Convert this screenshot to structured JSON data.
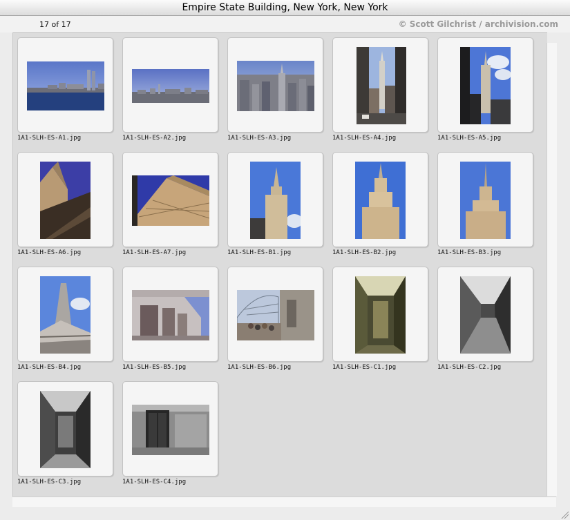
{
  "window": {
    "title": "Empire State Building, New York, New York"
  },
  "infobar": {
    "counter": "17 of 17",
    "copyright": "© Scott Gilchrist / archivision.com"
  },
  "thumbnails": [
    {
      "filename": "1A1-SLH-ES-A1.jpg",
      "orientation": "landscape"
    },
    {
      "filename": "1A1-SLH-ES-A2.jpg",
      "orientation": "landscape"
    },
    {
      "filename": "1A1-SLH-ES-A3.jpg",
      "orientation": "landscape"
    },
    {
      "filename": "1A1-SLH-ES-A4.jpg",
      "orientation": "portrait"
    },
    {
      "filename": "1A1-SLH-ES-A5.jpg",
      "orientation": "portrait"
    },
    {
      "filename": "1A1-SLH-ES-A6.jpg",
      "orientation": "portrait"
    },
    {
      "filename": "1A1-SLH-ES-A7.jpg",
      "orientation": "landscape"
    },
    {
      "filename": "1A1-SLH-ES-B1.jpg",
      "orientation": "portrait"
    },
    {
      "filename": "1A1-SLH-ES-B2.jpg",
      "orientation": "portrait"
    },
    {
      "filename": "1A1-SLH-ES-B3.jpg",
      "orientation": "portrait"
    },
    {
      "filename": "1A1-SLH-ES-B4.jpg",
      "orientation": "portrait"
    },
    {
      "filename": "1A1-SLH-ES-B5.jpg",
      "orientation": "landscape"
    },
    {
      "filename": "1A1-SLH-ES-B6.jpg",
      "orientation": "landscape"
    },
    {
      "filename": "1A1-SLH-ES-C1.jpg",
      "orientation": "portrait"
    },
    {
      "filename": "1A1-SLH-ES-C2.jpg",
      "orientation": "portrait"
    },
    {
      "filename": "1A1-SLH-ES-C3.jpg",
      "orientation": "portrait"
    },
    {
      "filename": "1A1-SLH-ES-C4.jpg",
      "orientation": "landscape"
    }
  ]
}
